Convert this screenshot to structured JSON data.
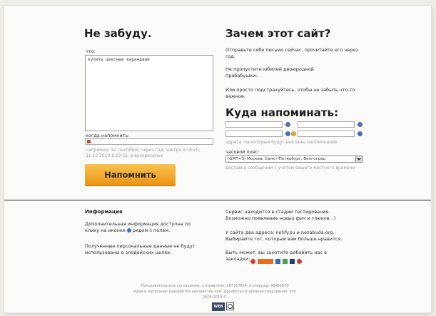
{
  "left": {
    "title": "Не забуду.",
    "what_label": "что:",
    "what_value": "купить цветные карандаши",
    "when_label": "когда напомнить:",
    "when_hint": "например: 12 сентября; через год; завтра в 18:20; 31.12.2010 в 23:55; в воскресенье",
    "remind_button": "Напомнить"
  },
  "right": {
    "title": "Зачем этот сайт?",
    "para1": "Отправьте себе письмо сейчас, прочитайте его через год.",
    "para2": "Не пропустите юбилей двоюродной прабабушки.",
    "para3": "Или просто подстрахуйтесь, чтобы не забыть что-то важное.",
    "where_title": "Куда напоминать:",
    "address_hint": "адреса, на которые будут высланы напоминания",
    "timezone_label": "часовой пояс:",
    "timezone_value": "(GMT+3) Москва, Санкт-Петербург, Волгоград",
    "timezone_hint": "доставка сообщений с учётом вашего местного времени"
  },
  "info": {
    "heading": "Информация",
    "p1": "Дополнительная информация доступна по клику на иконке",
    "p1_tail": "рядом с полем.",
    "p2": "Полученные персональные данные не будут использованы в злодейских целях."
  },
  "service": {
    "p1": "Сервис находится в стадии тестирования. Возможно появление новых фич и глюков. :)",
    "p2": "У сайта два адреса: notify.su и neza​buda.org. Выбирайте тот, который вам больше нравится.",
    "p3": "Быть может, вы захотите добавить нас в закладки:"
  },
  "footer": {
    "line1": "Пользовательское соглашение, отправлено: 287767864, в очереди: 98483878",
    "line2": "Идея и написание разработка неизвестно кем. Доработка и администрирование: info",
    "line3": "2008-2010 ©",
    "logo": "WEB"
  },
  "colors": {
    "accent": "#f3a728",
    "link_blue": "#4a6fb3"
  }
}
